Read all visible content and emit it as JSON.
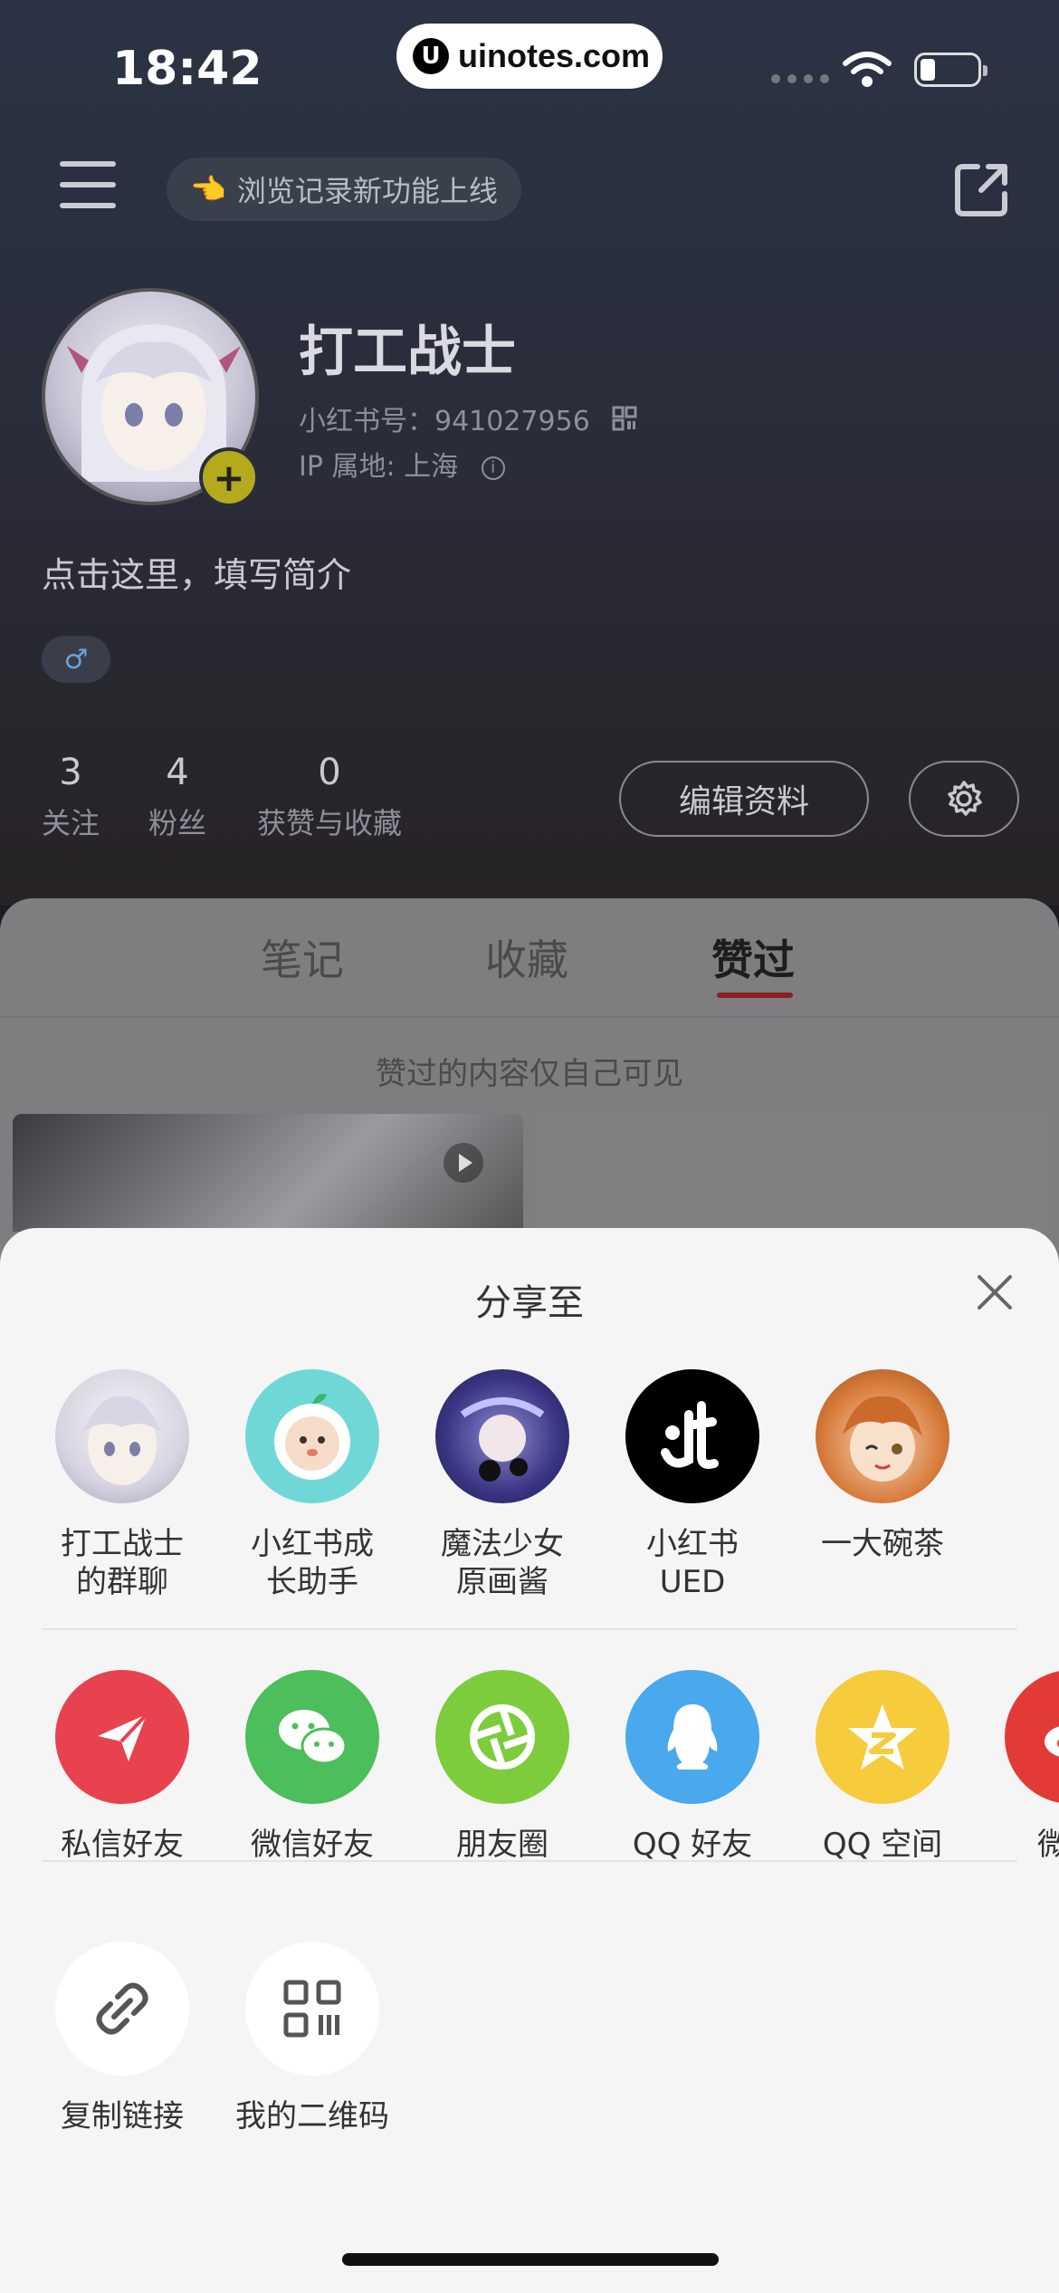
{
  "status_bar": {
    "time": "18:42",
    "watermark": "uinotes.com"
  },
  "header": {
    "history_banner": "浏览记录新功能上线"
  },
  "profile": {
    "name": "打工战士",
    "red_id": "小红书号：941027956",
    "ip_location": "IP 属地: 上海",
    "bio_placeholder": "点击这里，填写简介",
    "gender_symbol": "♂",
    "stats": [
      {
        "value": "3",
        "label": "关注"
      },
      {
        "value": "4",
        "label": "粉丝"
      },
      {
        "value": "0",
        "label": "获赞与收藏"
      }
    ],
    "edit_button": "编辑资料"
  },
  "tabs": [
    {
      "label": "笔记",
      "active": false
    },
    {
      "label": "收藏",
      "active": false
    },
    {
      "label": "赞过",
      "active": true
    }
  ],
  "likes_note": "赞过的内容仅自己可见",
  "share_sheet": {
    "title": "分享至",
    "contacts": [
      {
        "label": "打工战士\n的群聊",
        "line1": "打工战士",
        "line2": "的群聊",
        "icon": "group-chat-avatar"
      },
      {
        "label": "小红书成\n长助手",
        "line1": "小红书成",
        "line2": "长助手",
        "icon": "assistant-avatar"
      },
      {
        "label": "魔法少女\n原画酱",
        "line1": "魔法少女",
        "line2": "原画酱",
        "icon": "magic-girl-avatar"
      },
      {
        "label": "小红书\nUED",
        "line1": "小红书",
        "line2": "UED",
        "icon": "ued-avatar"
      },
      {
        "label": "一大碗茶",
        "line1": "一大碗茶",
        "line2": "",
        "icon": "tea-avatar"
      }
    ],
    "channels": [
      {
        "label": "私信好友",
        "icon": "paper-plane-icon",
        "color": "#e8424f"
      },
      {
        "label": "微信好友",
        "icon": "wechat-icon",
        "color": "#4cbe5c"
      },
      {
        "label": "朋友圈",
        "icon": "moments-icon",
        "color": "#7ccc3c"
      },
      {
        "label": "QQ 好友",
        "icon": "qq-icon",
        "color": "#4aa8ec"
      },
      {
        "label": "QQ 空间",
        "icon": "qzone-icon",
        "color": "#f6cb3c"
      },
      {
        "label": "微",
        "icon": "weibo-icon",
        "color": "#e23a36"
      }
    ],
    "actions": [
      {
        "label": "复制链接",
        "icon": "link-icon"
      },
      {
        "label": "我的二维码",
        "icon": "qr-code-icon"
      }
    ]
  },
  "colors": {
    "accent_red": "#8b1e26",
    "sheet_bg": "#f5f5f5"
  }
}
